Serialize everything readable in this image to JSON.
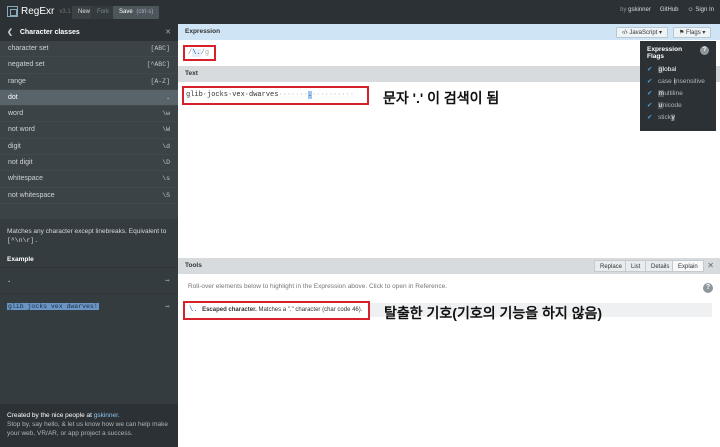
{
  "topbar": {
    "logo": "RegExr",
    "version": "v3.1",
    "new_label": "New",
    "fork_label": "Fork",
    "save_label": "Save",
    "save_hint": "(ctrl-s)",
    "by_label": "by",
    "user": "gskinner",
    "github": "GitHub",
    "signin": "Sign In"
  },
  "sidebar": {
    "title": "Character classes",
    "items": [
      {
        "label": "character set",
        "token": "[ABC]"
      },
      {
        "label": "negated set",
        "token": "[^ABC]"
      },
      {
        "label": "range",
        "token": "[A-Z]"
      },
      {
        "label": "dot",
        "token": "."
      },
      {
        "label": "word",
        "token": "\\w"
      },
      {
        "label": "not word",
        "token": "\\W"
      },
      {
        "label": "digit",
        "token": "\\d"
      },
      {
        "label": "not digit",
        "token": "\\D"
      },
      {
        "label": "whitespace",
        "token": "\\s"
      },
      {
        "label": "not whitespace",
        "token": "\\S"
      }
    ],
    "description": "Matches any character except linebreaks. Equivalent to",
    "description_code": "[^\\n\\r].",
    "example_title": "Example",
    "example_expr": ".",
    "example_text": "glib jocks vex dwarves!",
    "footer_lead": "Created by the nice people at",
    "footer_link": "gskinner.",
    "footer_text": "Stop by, say hello, & let us know how we can help make your web, VR/AR, or app project a success."
  },
  "expression": {
    "title": "Expression",
    "slash_open": "/",
    "escaped": "\\.",
    "slash_close": "/",
    "flags": "g",
    "engine_label": "JavaScript",
    "flags_label": "Flags"
  },
  "text": {
    "title": "Text",
    "content_before": "glib·jocks·vex·dwarves",
    "dots_before": "·······",
    "match": ".",
    "dots_after": "··········",
    "annotation": "문자 '.' 이 검색이 됨"
  },
  "tools": {
    "title": "Tools",
    "tabs": [
      "Replace",
      "List",
      "Details",
      "Explain"
    ],
    "active_tab": "Explain",
    "hint": "Roll-over elements below to highlight in the Expression above. Click to open in Reference.",
    "explain_code": "\\.",
    "explain_title": "Escaped character.",
    "explain_text": "Matches a \".\" character (char code 46).",
    "annotation": "탈출한 기호(기호의 기능을 하지 않음)"
  },
  "flags_menu": {
    "title": "Expression Flags",
    "items": [
      {
        "prefix": "",
        "key": "g",
        "rest": "lobal",
        "on": true
      },
      {
        "prefix": "case ",
        "key": "i",
        "rest": "nsensitive",
        "on": false
      },
      {
        "prefix": "",
        "key": "m",
        "rest": "ultiline",
        "on": false
      },
      {
        "prefix": "",
        "key": "u",
        "rest": "nicode",
        "on": false
      },
      {
        "prefix": "stick",
        "key": "y",
        "rest": "",
        "on": false
      }
    ]
  },
  "colors": {
    "accent_red": "#d6202a",
    "match_blue": "#9dc7ef",
    "sidebar_bg": "#3b4347",
    "topbar_bg": "#2b3135"
  }
}
